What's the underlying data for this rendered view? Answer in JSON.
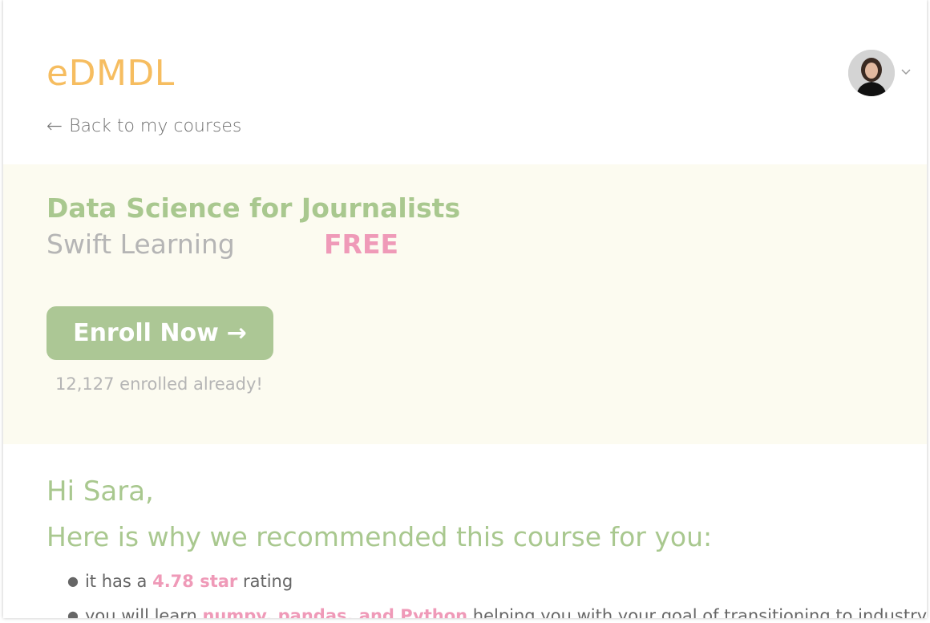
{
  "header": {
    "logo": "eDMDL",
    "back_arrow": "←",
    "back_label": "Back to my courses"
  },
  "user": {
    "avatar_icon": "user-avatar",
    "menu_icon": "chevron-down-icon"
  },
  "course": {
    "title": "Data Science for Journalists",
    "provider": "Swift Learning",
    "price": "FREE",
    "enroll_label": "Enroll Now",
    "enroll_arrow": "→",
    "enrolled_text": "12,127 enrolled already!"
  },
  "recommendation": {
    "greeting": "Hi Sara,",
    "heading": "Here is why we recommended this course for you:",
    "reasons": [
      {
        "before": "it has a",
        "highlight": "4.78 star",
        "after": "rating"
      },
      {
        "before": "you will learn",
        "highlight": "numpy, pandas, and Python",
        "after": "helping you with your goal of transitioning to industry."
      }
    ]
  },
  "colors": {
    "logo": "#f6bd60",
    "accent_green": "#a9c88f",
    "button_green": "#acc795",
    "highlight_pink": "#ef9ab8",
    "hero_bg": "#fcfbf0"
  }
}
